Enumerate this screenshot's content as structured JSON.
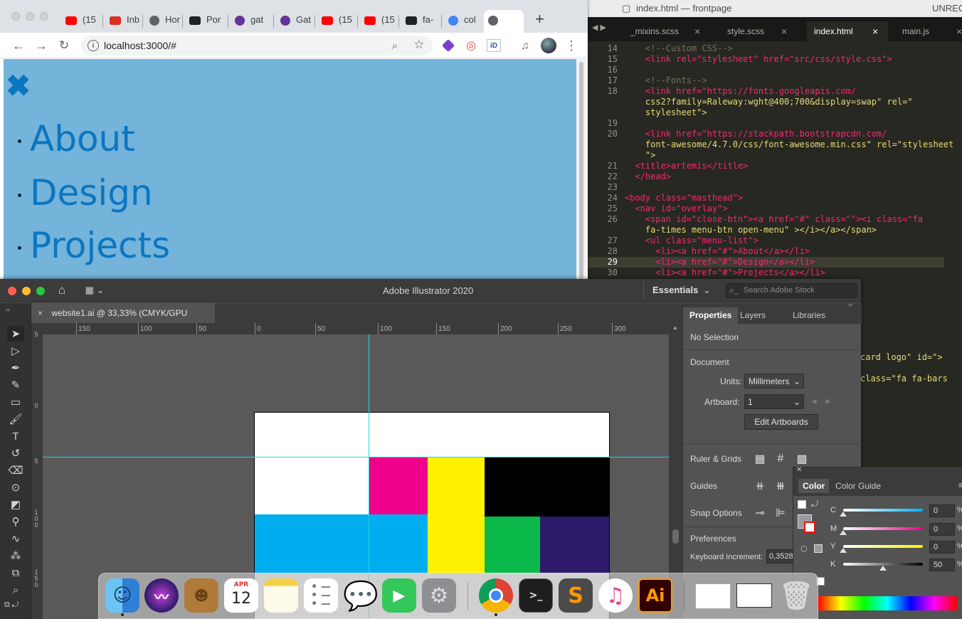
{
  "sublime": {
    "window_title": "index.html — frontpage",
    "unregistered": "UNREG",
    "tabs": [
      {
        "label": "_mixins.scss",
        "close": "×"
      },
      {
        "label": "style.scss",
        "close": "×"
      },
      {
        "label": "index.html",
        "close": "×"
      },
      {
        "label": "main.js",
        "close": "×"
      }
    ],
    "line_numbers": [
      "14",
      "15",
      "16",
      "17",
      "18",
      "19",
      "20",
      "21",
      "22",
      "23",
      "24",
      "25",
      "26",
      "27",
      "28",
      "29",
      "30"
    ],
    "current_line": "29",
    "code": [
      [
        "    ",
        "<!--Custom CSS-->"
      ],
      [
        "    ",
        "<link rel=\"stylesheet\" href=\"src/css/style.css\">"
      ],
      [
        "",
        ""
      ],
      [
        "    ",
        "<!--Fonts-->"
      ],
      [
        "    ",
        "<link href=\"https://fonts.googleapis.com/"
      ],
      [
        "    ",
        "css2?family=Raleway:wght@400;700&display=swap\" rel=\""
      ],
      [
        "    ",
        "stylesheet\">"
      ],
      [
        "",
        ""
      ],
      [
        "    ",
        "<link href=\"https://stackpath.bootstrapcdn.com/"
      ],
      [
        "    ",
        "font-awesome/4.7.0/css/font-awesome.min.css\" rel=\"stylesheet"
      ],
      [
        "    ",
        "\">"
      ],
      [
        "  ",
        "<title>artemis</title>"
      ],
      [
        "  ",
        "</head>"
      ],
      [
        "",
        ""
      ],
      [
        "",
        "<body class=\"masthead\">"
      ],
      [
        "  ",
        "<nav id=\"overlay\">"
      ],
      [
        "    ",
        "<span id=\"close-btn\"><a href=\"#\" class=\"\"><i class=\"fa"
      ],
      [
        "    ",
        "fa-times menu-btn open-menu\" ></i></a></span>"
      ],
      [
        "    ",
        "<ul class=\"menu-list\">"
      ],
      [
        "      ",
        "<li><a href=\"#\">About</a></li>"
      ],
      [
        "      ",
        "<li><a href=\"#\">Design</a></li>"
      ],
      [
        "      ",
        "<li><a href=\"#\">Projects</a></li>"
      ]
    ],
    "peek_line_1": "card logo\" id=\">",
    "peek_line_2": "class=\"fa fa-bars"
  },
  "chrome": {
    "tabs": [
      {
        "label": "(15",
        "icon": "youtube-icon",
        "color": "#ff0000"
      },
      {
        "label": "Inb",
        "icon": "gmail-icon",
        "color": "#d93025"
      },
      {
        "label": "Hor",
        "icon": "globe-icon",
        "color": "#5f6368"
      },
      {
        "label": "Por",
        "icon": "portfolio-icon",
        "color": "#202124"
      },
      {
        "label": "gat",
        "icon": "gatsby-icon",
        "color": "#663399"
      },
      {
        "label": "Gat",
        "icon": "gatsby-icon",
        "color": "#663399"
      },
      {
        "label": "(15",
        "icon": "youtube-icon",
        "color": "#ff0000"
      },
      {
        "label": "(15",
        "icon": "youtube-icon",
        "color": "#ff0000"
      },
      {
        "label": "fa-",
        "icon": "flag-icon",
        "color": "#202124"
      },
      {
        "label": "col",
        "icon": "google-icon",
        "color": "#4285f4"
      },
      {
        "label": "",
        "icon": "globe-icon",
        "color": "#5f6368"
      }
    ],
    "close_tab": "×",
    "new_tab": "+",
    "url": "localhost:3000/#",
    "menu_items": [
      "About",
      "Design",
      "Projects"
    ],
    "close_icon": "✖"
  },
  "illustrator": {
    "app_title": "Adobe Illustrator 2020",
    "workspace": "Essentials",
    "search_placeholder": "Search Adobe Stock",
    "doc_tab": "website1.ai @ 33,33% (CMYK/GPU Preview)",
    "doc_close": "×",
    "ruler_h": [
      "150",
      "100",
      "50",
      "0",
      "50",
      "100",
      "150",
      "200",
      "250",
      "300"
    ],
    "ruler_v": [
      "5",
      "0",
      "5",
      "1 0 0",
      "1 5 0"
    ],
    "panel_tabs": [
      "Properties",
      "Layers",
      "Libraries"
    ],
    "no_selection": "No Selection",
    "document_heading": "Document",
    "units_label": "Units:",
    "units_value": "Millimeters",
    "artboard_label": "Artboard:",
    "artboard_value": "1",
    "edit_artboards": "Edit Artboards",
    "ruler_grids": "Ruler & Grids",
    "guides": "Guides",
    "snap_options": "Snap Options",
    "preferences": "Preferences",
    "keyboard_increment_label": "Keyboard Increment:",
    "keyboard_increment_value": "0,3528",
    "swatch_colors": {
      "magenta": "#ec008c",
      "yellow": "#fff200",
      "black": "#000000",
      "cyan": "#00aeef",
      "green": "#0bb94b",
      "purple": "#2e1a6b"
    }
  },
  "color_panel": {
    "tabs": [
      "Color",
      "Color Guide"
    ],
    "channels": [
      {
        "label": "C",
        "value": "0",
        "unit": "%",
        "fraction": 0.0,
        "from": "#ffffff",
        "to": "#00aeef"
      },
      {
        "label": "M",
        "value": "0",
        "unit": "%",
        "fraction": 0.0,
        "from": "#ffffff",
        "to": "#ec008c"
      },
      {
        "label": "Y",
        "value": "0",
        "unit": "%",
        "fraction": 0.0,
        "from": "#ffffff",
        "to": "#fff200"
      },
      {
        "label": "K",
        "value": "50",
        "unit": "%",
        "fraction": 0.5,
        "from": "#ffffff",
        "to": "#000000"
      }
    ]
  },
  "dock": {
    "calendar_month": "APR",
    "calendar_day": "12",
    "apps": [
      "Finder",
      "Siri",
      "Contacts",
      "Calendar",
      "Notes",
      "Reminders",
      "Messages",
      "FaceTime",
      "System Preferences",
      "Chrome",
      "Terminal",
      "Sublime Text",
      "iTunes",
      "Illustrator"
    ],
    "illustrator_label": "Ai",
    "terminal_label": ">_"
  }
}
